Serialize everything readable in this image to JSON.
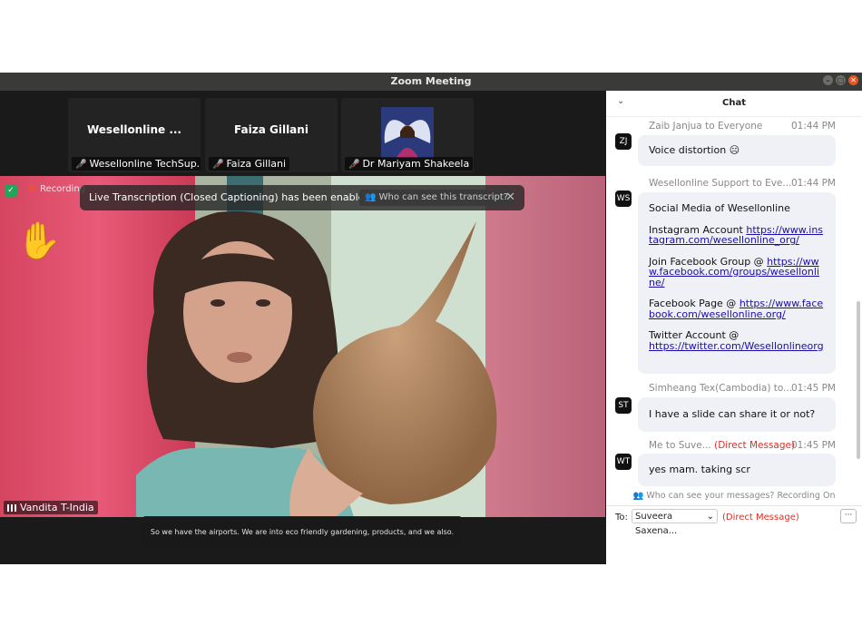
{
  "window": {
    "title": "Zoom Meeting"
  },
  "thumbnails": [
    {
      "big_name": "Wesellonline ...",
      "footer": "Wesellonline TechSup..."
    },
    {
      "big_name": "Faiza Gillani",
      "footer": "Faiza Gillani"
    },
    {
      "footer": "Dr Mariyam Shakeela"
    }
  ],
  "banner": {
    "text": "Live Transcription (Closed Captioning) has been enabled",
    "link": "Who can see this transcript?",
    "close": "✕"
  },
  "recording": {
    "label": "Recording"
  },
  "speaker": {
    "name": "Vandita T-India"
  },
  "caption": {
    "text": "So we have the airports. We are into eco friendly gardening, products, and we also."
  },
  "chat": {
    "title": "Chat",
    "messages": [
      {
        "avatar": "ZJ",
        "sender": "Zaib Janjua to Everyone",
        "time": "01:44 PM",
        "text": "Voice distortion ☹"
      },
      {
        "avatar": "WS",
        "sender": "Wesellonline Support to Eve...",
        "time": "01:44 PM",
        "heading": "Social Media of Wesellonline",
        "instagram_label": "Instagram Account ",
        "instagram_url": "https://www.instagram.com/wesellonline_org/",
        "fb_group_label": "Join Facebook Group @ ",
        "fb_group_url": "https://www.facebook.com/groups/wesellonline/",
        "fb_page_label": "Facebook Page @ ",
        "fb_page_url": "https://www.facebook.com/wesellonline.org/",
        "twitter_label": "Twitter Account @",
        "twitter_url": "https://twitter.com/Wesellonlineorg"
      },
      {
        "avatar": "ST",
        "sender": "Simheang Tex(Cambodia) to...",
        "time": "01:45 PM",
        "text": "I have a slide can share it or not?"
      },
      {
        "avatar": "WT",
        "sender": "Me to Suve...",
        "dm": "(Direct Message)",
        "time": "01:45 PM",
        "text": "yes mam. taking scr"
      }
    ],
    "privacy_note": "Who can see your messages? Recording On",
    "to_label": "To:",
    "recipient": "Suveera Saxena...",
    "recipient_dm": "(Direct Message)",
    "more": "···"
  },
  "colors": {
    "accent_red": "#d93025",
    "bubble_bg": "#eff1f6",
    "titlebar": "#3a3a38"
  }
}
